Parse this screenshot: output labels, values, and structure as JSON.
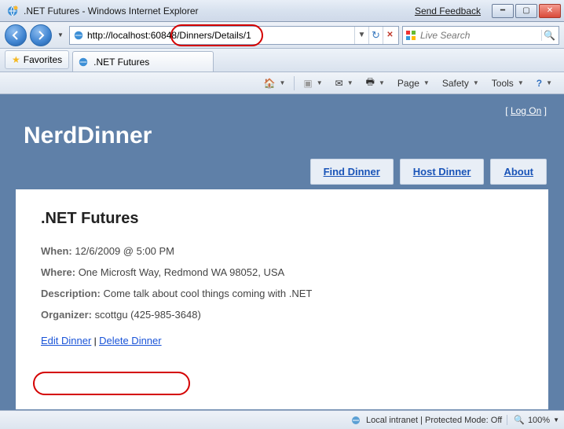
{
  "window": {
    "title": ".NET Futures - Windows Internet Explorer",
    "feedback": "Send Feedback"
  },
  "address": {
    "url": "http://localhost:60848/Dinners/Details/1"
  },
  "search": {
    "placeholder": "Live Search"
  },
  "favorites": {
    "label": "Favorites"
  },
  "tab": {
    "label": ".NET Futures"
  },
  "cmd": {
    "page": "Page",
    "safety": "Safety",
    "tools": "Tools"
  },
  "site": {
    "logon_left": "[ ",
    "logon_link": "Log On",
    "logon_right": " ]",
    "brand": "NerdDinner",
    "nav": {
      "find": "Find Dinner",
      "host": "Host Dinner",
      "about": "About"
    }
  },
  "content": {
    "title": ".NET Futures",
    "when_label": "When:",
    "when_value": "12/6/2009 @ 5:00 PM",
    "where_label": "Where:",
    "where_value": "One Microsft Way, Redmond WA 98052, USA",
    "desc_label": "Description:",
    "desc_value": "Come talk about cool things coming with .NET",
    "org_label": "Organizer:",
    "org_value": "scottgu (425-985-3648)",
    "edit": "Edit Dinner",
    "sep": " | ",
    "delete": "Delete Dinner"
  },
  "status": {
    "zone": "Local intranet | Protected Mode: Off",
    "zoom": "100%"
  }
}
